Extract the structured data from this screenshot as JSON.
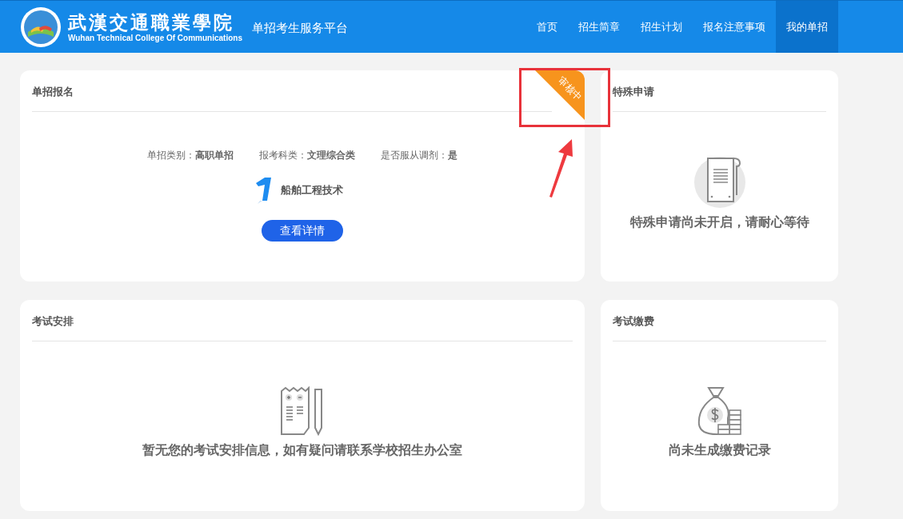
{
  "header": {
    "logo": {
      "name_cn": "武漢交通職業學院",
      "name_en": "Wuhan Technical College Of Communications"
    },
    "platform_title": "单招考生服务平台",
    "nav": [
      {
        "label": "首页",
        "selected": false
      },
      {
        "label": "招生简章",
        "selected": false
      },
      {
        "label": "招生计划",
        "selected": false
      },
      {
        "label": "报名注意事项",
        "selected": false
      },
      {
        "label": "我的单招",
        "selected": true
      }
    ]
  },
  "registration": {
    "title": "单招报名",
    "status_badge": "审核中",
    "fields": [
      "单招类别：**高职单招**",
      "报考科类：**文理综合类**",
      "是否服从调剂：**是**"
    ],
    "major": "船舶工程技术",
    "button": "查看详情"
  },
  "special_application": {
    "title": "特殊申请",
    "message": "特殊申请尚未开启，请耐心等待"
  },
  "exam_schedule": {
    "title": "考试安排",
    "message": "暂无您的考试安排信息，如有疑问请联系学校招生办公室"
  },
  "exam_payment": {
    "title": "考试缴费",
    "message": "尚未生成缴费记录"
  }
}
